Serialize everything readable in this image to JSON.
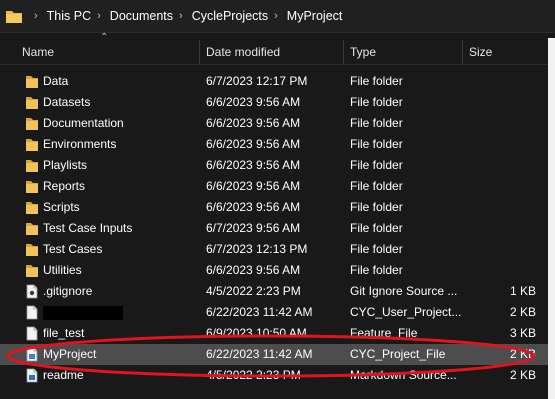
{
  "breadcrumb": [
    "This PC",
    "Documents",
    "CycleProjects",
    "MyProject"
  ],
  "columns": {
    "name": "Name",
    "date": "Date modified",
    "type": "Type",
    "size": "Size"
  },
  "colors": {
    "folder": "#e8b64c",
    "selected_row": "#4d4d4d",
    "highlight_ellipse": "#e0141c"
  },
  "rows": [
    {
      "name": "Data",
      "date": "6/7/2023 12:17 PM",
      "type": "File folder",
      "size": "",
      "icon": "folder-icon"
    },
    {
      "name": "Datasets",
      "date": "6/6/2023 9:56 AM",
      "type": "File folder",
      "size": "",
      "icon": "folder-icon"
    },
    {
      "name": "Documentation",
      "date": "6/6/2023 9:56 AM",
      "type": "File folder",
      "size": "",
      "icon": "folder-icon"
    },
    {
      "name": "Environments",
      "date": "6/6/2023 9:56 AM",
      "type": "File folder",
      "size": "",
      "icon": "folder-icon"
    },
    {
      "name": "Playlists",
      "date": "6/6/2023 9:56 AM",
      "type": "File folder",
      "size": "",
      "icon": "folder-icon"
    },
    {
      "name": "Reports",
      "date": "6/6/2023 9:56 AM",
      "type": "File folder",
      "size": "",
      "icon": "folder-icon"
    },
    {
      "name": "Scripts",
      "date": "6/6/2023 9:56 AM",
      "type": "File folder",
      "size": "",
      "icon": "folder-icon"
    },
    {
      "name": "Test Case Inputs",
      "date": "6/7/2023 9:56 AM",
      "type": "File folder",
      "size": "",
      "icon": "folder-icon"
    },
    {
      "name": "Test Cases",
      "date": "6/7/2023 12:13 PM",
      "type": "File folder",
      "size": "",
      "icon": "folder-icon"
    },
    {
      "name": "Utilities",
      "date": "6/6/2023 9:56 AM",
      "type": "File folder",
      "size": "",
      "icon": "folder-icon"
    },
    {
      "name": ".gitignore",
      "date": "4/5/2022 2:23 PM",
      "type": "Git Ignore Source ...",
      "size": "1 KB",
      "icon": "git-file-icon"
    },
    {
      "name": "",
      "date": "6/22/2023 11:42 AM",
      "type": "CYC_User_Project...",
      "size": "2 KB",
      "icon": "document-icon",
      "redacted": true
    },
    {
      "name": "file_test",
      "date": "6/9/2023 10:50 AM",
      "type": "Feature_File",
      "size": "3 KB",
      "icon": "document-icon"
    },
    {
      "name": "MyProject",
      "date": "6/22/2023 11:42 AM",
      "type": "CYC_Project_File",
      "size": "2 KB",
      "icon": "project-file-icon",
      "selected": true
    },
    {
      "name": "readme",
      "date": "4/5/2022 2:23 PM",
      "type": "Markdown Source...",
      "size": "2 KB",
      "icon": "markdown-file-icon"
    }
  ]
}
